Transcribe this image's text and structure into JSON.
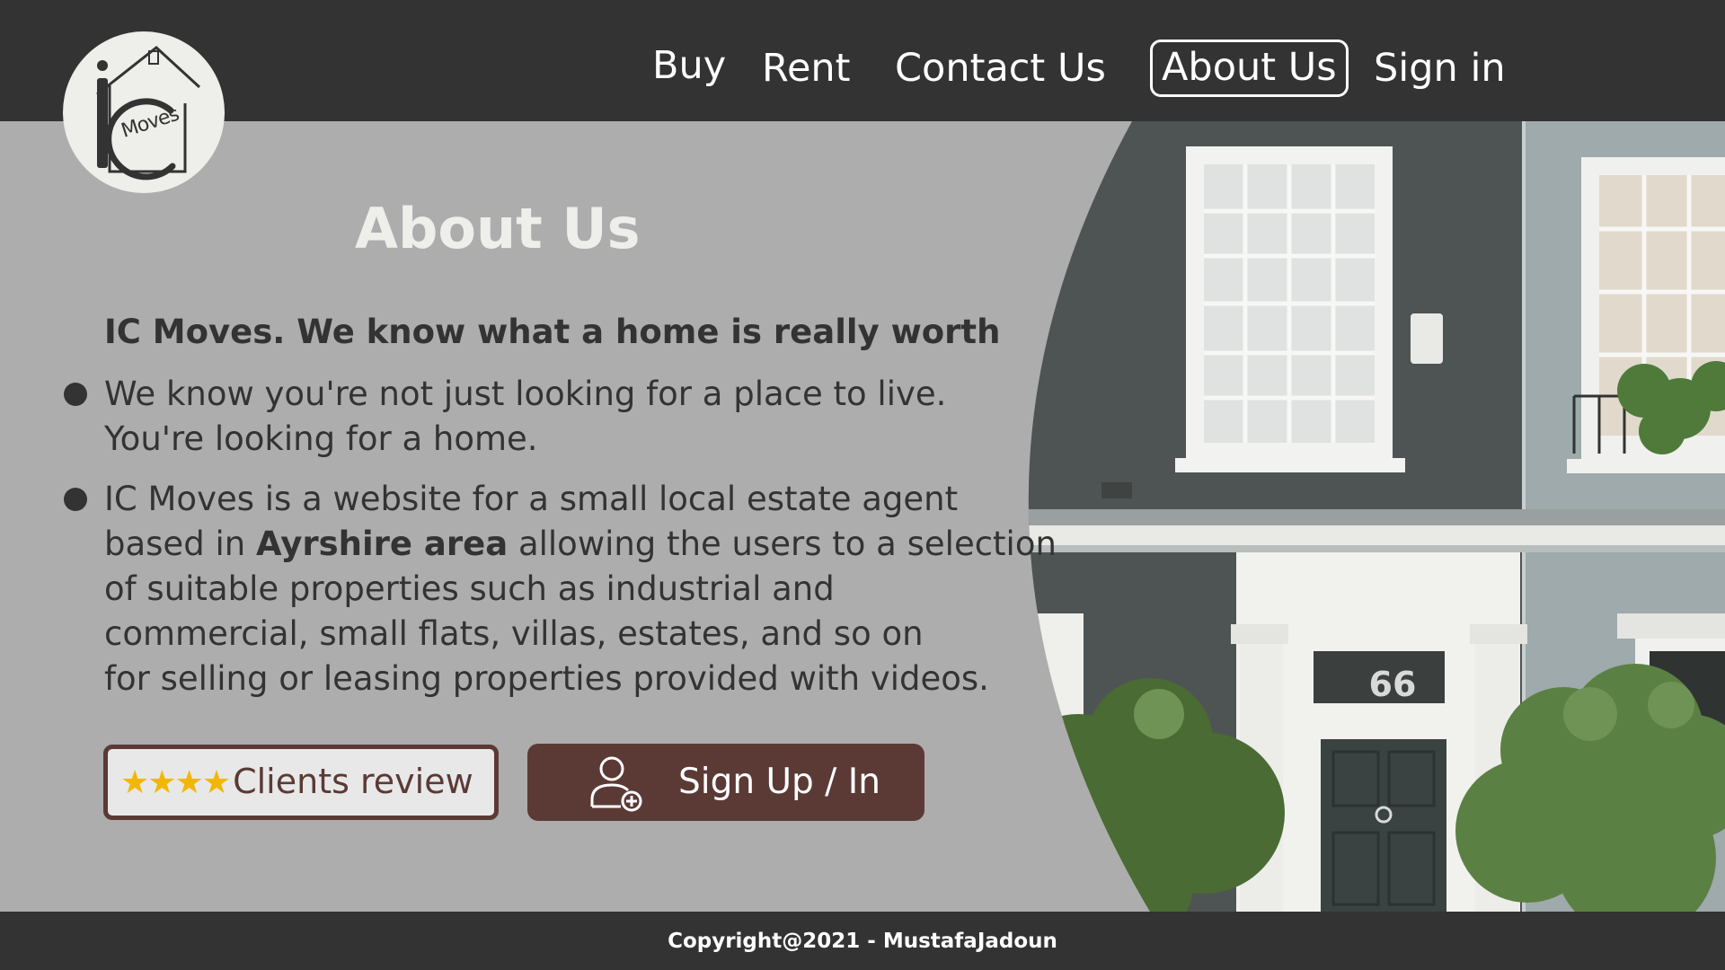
{
  "nav": {
    "items": [
      {
        "label": "Buy"
      },
      {
        "label": "Rent"
      },
      {
        "label": "Contact Us"
      },
      {
        "label": "About Us",
        "active": true
      },
      {
        "label": "Sign in"
      }
    ]
  },
  "logo": {
    "letters": "IC",
    "word": "Moves"
  },
  "main": {
    "title": "About Us",
    "tagline": "IC Moves. We know what a home is really worth",
    "para1": {
      "line1": "We know you're not just looking for a place to live.",
      "line2": "You're looking for a home."
    },
    "para2": {
      "line1": "IC Moves is a website for a small local estate agent",
      "line2_before": "based in ",
      "line2_bold": "Ayrshire area",
      "line2_after": " allowing the users to a selection",
      "line3": "of suitable properties such as industrial and",
      "line4": "commercial, small flats, villas, estates, and so on",
      "line5": "for selling or leasing properties provided with videos."
    }
  },
  "buttons": {
    "review_stars": "★★★★",
    "review_label": "Clients review",
    "signup_label": "Sign Up / In"
  },
  "photo": {
    "house_number": "66"
  },
  "footer": {
    "copyright": "Copyright@2021 - MustafaJadoun"
  },
  "colors": {
    "header_bg": "#333333",
    "content_bg": "#adadad",
    "accent_brown": "#5b3a36",
    "star_gold": "#f2b705"
  }
}
